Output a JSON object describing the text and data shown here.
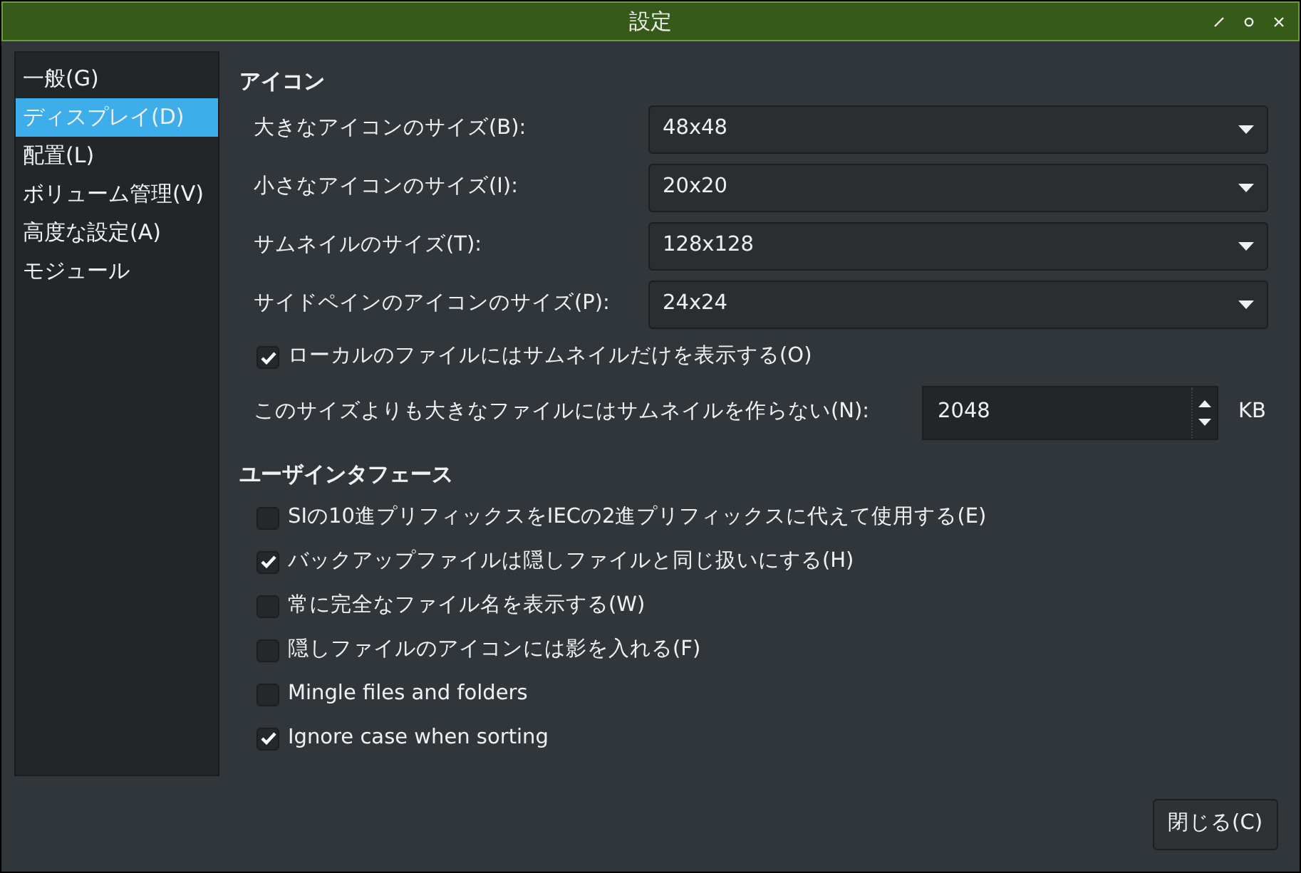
{
  "window": {
    "title": "設定"
  },
  "sidebar": {
    "items": [
      {
        "label": "一般(G)",
        "selected": false
      },
      {
        "label": "ディスプレイ(D)",
        "selected": true
      },
      {
        "label": "配置(L)",
        "selected": false
      },
      {
        "label": "ボリューム管理(V)",
        "selected": false
      },
      {
        "label": "高度な設定(A)",
        "selected": false
      },
      {
        "label": "モジュール",
        "selected": false
      }
    ]
  },
  "icons_section": {
    "heading": "アイコン",
    "rows": [
      {
        "kind": "combo",
        "label": "大きなアイコンのサイズ(B):",
        "value": "48x48"
      },
      {
        "kind": "combo",
        "label": "小さなアイコンのサイズ(I):",
        "value": "20x20"
      },
      {
        "kind": "combo",
        "label": "サムネイルのサイズ(T):",
        "value": "128x128"
      },
      {
        "kind": "combo",
        "label": "サイドペインのアイコンのサイズ(P):",
        "value": "24x24"
      },
      {
        "kind": "checkbox",
        "label": "ローカルのファイルにはサムネイルだけを表示する(O)",
        "checked": true
      },
      {
        "kind": "spin",
        "label": "このサイズよりも大きなファイルにはサムネイルを作らない(N):",
        "value": "2048",
        "unit": "KB"
      }
    ]
  },
  "ui_section": {
    "heading": "ユーザインタフェース",
    "checkboxes": [
      {
        "label": "SIの10進プリフィックスをIECの2進プリフィックスに代えて使用する(E)",
        "checked": false
      },
      {
        "label": "バックアップファイルは隠しファイルと同じ扱いにする(H)",
        "checked": true
      },
      {
        "label": "常に完全なファイル名を表示する(W)",
        "checked": false
      },
      {
        "label": "隠しファイルのアイコンには影を入れる(F)",
        "checked": false
      },
      {
        "label": "Mingle files and folders",
        "checked": false
      },
      {
        "label": "Ignore case when sorting",
        "checked": true
      }
    ]
  },
  "buttons": [
    {
      "label": "閉じる(C)"
    }
  ]
}
